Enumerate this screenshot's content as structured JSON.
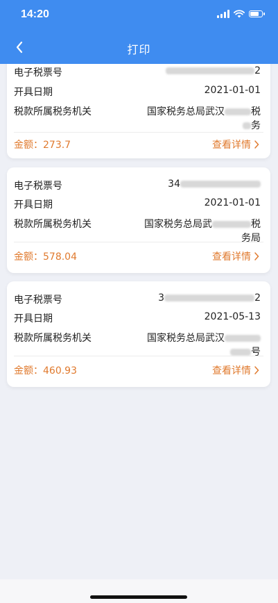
{
  "status": {
    "time": "14:20",
    "battery_level": 0.85
  },
  "nav": {
    "title": "打印"
  },
  "labels": {
    "ticket_no": "电子税票号",
    "issue_date": "开具日期",
    "tax_office": "税款所属税务机关",
    "detail_link": "查看详情"
  },
  "cards": [
    {
      "ticket_prefix": "",
      "ticket_suffix": "2",
      "issue_date": "2021-01-01",
      "tax_office_line1": "国家税务总局武汉",
      "tax_office_line1_tail": "税",
      "tax_office_line2": "务",
      "amount": "金额：273.7"
    },
    {
      "ticket_prefix": "34",
      "ticket_suffix": "",
      "issue_date": "2021-01-01",
      "tax_office_line1": "国家税务总局武",
      "tax_office_line1_tail": "税",
      "tax_office_line2": "务局",
      "amount": "金额：578.04"
    },
    {
      "ticket_prefix": "3",
      "ticket_suffix": "2",
      "issue_date": "2021-05-13",
      "tax_office_line1": "国家税务总局武汉",
      "tax_office_line1_tail": "",
      "tax_office_line2": "号",
      "amount": "金额：460.93"
    }
  ],
  "colors": {
    "nav_bg": "#3f8cf0",
    "accent": "#e07a2e",
    "page_bg": "#eef0f6"
  }
}
